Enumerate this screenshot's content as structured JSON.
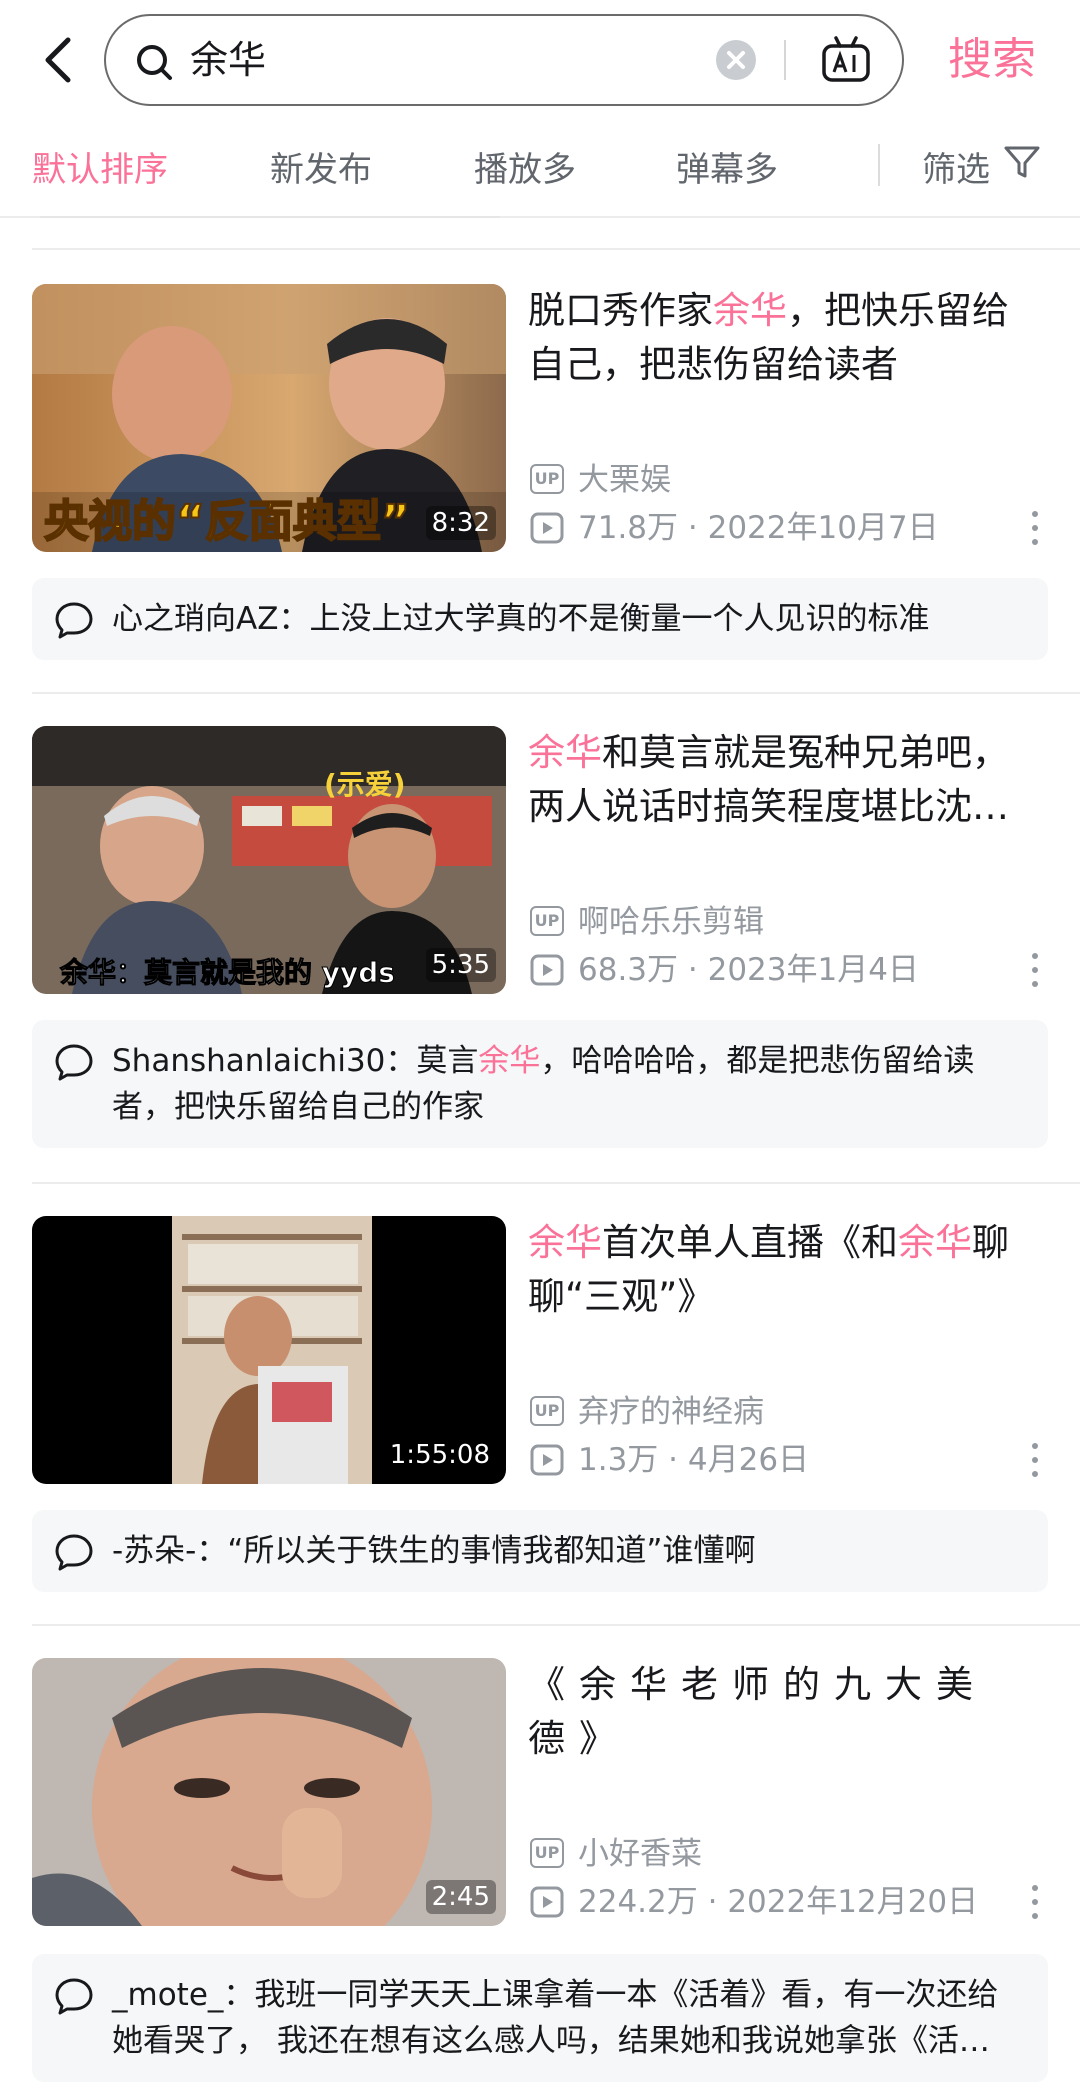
{
  "search": {
    "query": "余华",
    "button_label": "搜索",
    "icons": [
      "back-icon",
      "search-icon",
      "clear-icon",
      "ai-icon"
    ]
  },
  "sort_tabs": [
    {
      "label": "默认排序",
      "active": true
    },
    {
      "label": "新发布",
      "active": false
    },
    {
      "label": "播放多",
      "active": false
    },
    {
      "label": "弹幕多",
      "active": false
    }
  ],
  "filter_label": "筛选",
  "colors": {
    "accent": "#fb7299",
    "text": "#18191c",
    "muted": "#9499a0",
    "comment_bg": "#f6f7f8"
  },
  "videos": [
    {
      "title_pre": "脱口秀作家",
      "title_hl": "余华",
      "title_post": "，把快乐留给自己，把悲伤留给读者",
      "thumb_caption": "央视的“反面典型”",
      "duration": "8:32",
      "uploader": "大栗娱",
      "views": "71.8万",
      "date": "2022年10月7日",
      "comment_user": "心之琑向AZ",
      "comment_text": "上没上过大学真的不是衡量一个人见识的标准"
    },
    {
      "title_pre": "",
      "title_hl": "余华",
      "title_post": "和莫言就是冤种兄弟吧，两人说话时搞笑程度堪比沈…",
      "thumb_caption": "余华：莫言就是我的 yyds",
      "thumb_tag": "(示爱)",
      "duration": "5:35",
      "uploader": "啊哈乐乐剪辑",
      "views": "68.3万",
      "date": "2023年1月4日",
      "comment_user": "Shanshanlaichi30",
      "comment_pre": "莫言",
      "comment_hl": "余华",
      "comment_post": "，哈哈哈哈，都是把悲伤留给读者，把快乐留给自己的作家"
    },
    {
      "title_hl1": "余华",
      "title_mid": "首次单人直播《和",
      "title_hl2": "余华",
      "title_post": "聊聊“三观”》",
      "duration": "1:55:08",
      "uploader": "弃疗的神经病",
      "views": "1.3万",
      "date": "4月26日",
      "comment_user": "-苏朵-",
      "comment_text": "“所以关于铁生的事情我都知道”谁懂啊"
    },
    {
      "title": "《余华老师的九大美德》",
      "duration": "2:45",
      "uploader": "小好香菜",
      "views": "224.2万",
      "date": "2022年12月20日",
      "comment_user": "_mote_",
      "comment_text": "我班一同学天天上课拿着一本《活着》看，有一次还给她看哭了， 我还在想有这么感人吗，结果她和我说她拿张《活…"
    }
  ],
  "labels": {
    "up_badge": "UP",
    "meta_sep": " · ",
    "colon": "："
  }
}
